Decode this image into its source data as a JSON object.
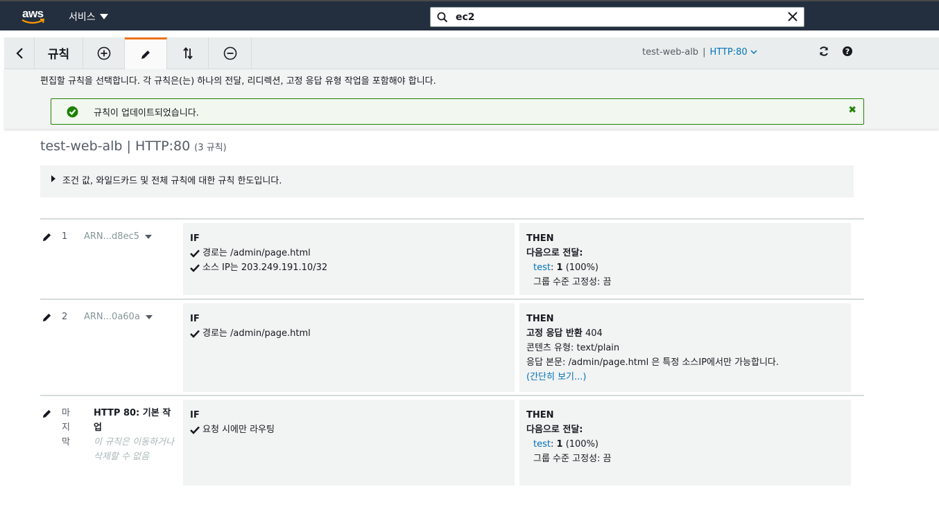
{
  "topnav": {
    "logo_text": "aws",
    "services_label": "서비스",
    "search_value": "ec2"
  },
  "toolbar": {
    "title": "규칙",
    "context_lb": "test-web-alb",
    "context_sep": "|",
    "context_listener": "HTTP:80"
  },
  "info": {
    "description": "편집할 규칙을 선택합니다. 각 규칙은(는) 하나의 전달, 리디렉션, 고정 응답 유형 작업을 포함해야 합니다.",
    "flash_message": "규칙이 업데이트되었습니다."
  },
  "header": {
    "title": "test-web-alb | HTTP:80",
    "rule_count": "(3 규칙)",
    "limits_label": "조건 값, 와일드카드 및 전체 규칙에 대한 규칙 한도입니다."
  },
  "rules": [
    {
      "priority": "1",
      "arn": "ARN...d8ec5",
      "if_label": "IF",
      "conditions": [
        "경로는 /admin/page.html",
        "소스 IP는 203.249.191.10/32"
      ],
      "then_label": "THEN",
      "action_title": "다음으로 전달:",
      "target_name": "test",
      "target_sep": ":",
      "target_weight": "1",
      "target_pct": "(100%)",
      "stickiness": "그룹 수준 고정성: 끔"
    },
    {
      "priority": "2",
      "arn": "ARN...0a60a",
      "if_label": "IF",
      "conditions": [
        "경로는 /admin/page.html"
      ],
      "then_label": "THEN",
      "action_title": "고정 응답 반환",
      "status_code": "404",
      "content_type": "콘텐츠 유형: text/plain",
      "response_body": "응답 본문: /admin/page.html 은 특정 소스IP에서만 가능합니다.",
      "show_less": "(간단히 보기...)"
    },
    {
      "priority_chars": [
        "마",
        "지",
        "막"
      ],
      "default_title": "HTTP 80: 기본 작업",
      "default_note": "이 규칙은 이동하거나 삭제할 수 없음",
      "if_label": "IF",
      "conditions": [
        "요청 시에만 라우팅"
      ],
      "then_label": "THEN",
      "action_title": "다음으로 전달:",
      "target_name": "test",
      "target_sep": ":",
      "target_weight": "1",
      "target_pct": "(100%)",
      "stickiness": "그룹 수준 고정성: 끔"
    }
  ]
}
